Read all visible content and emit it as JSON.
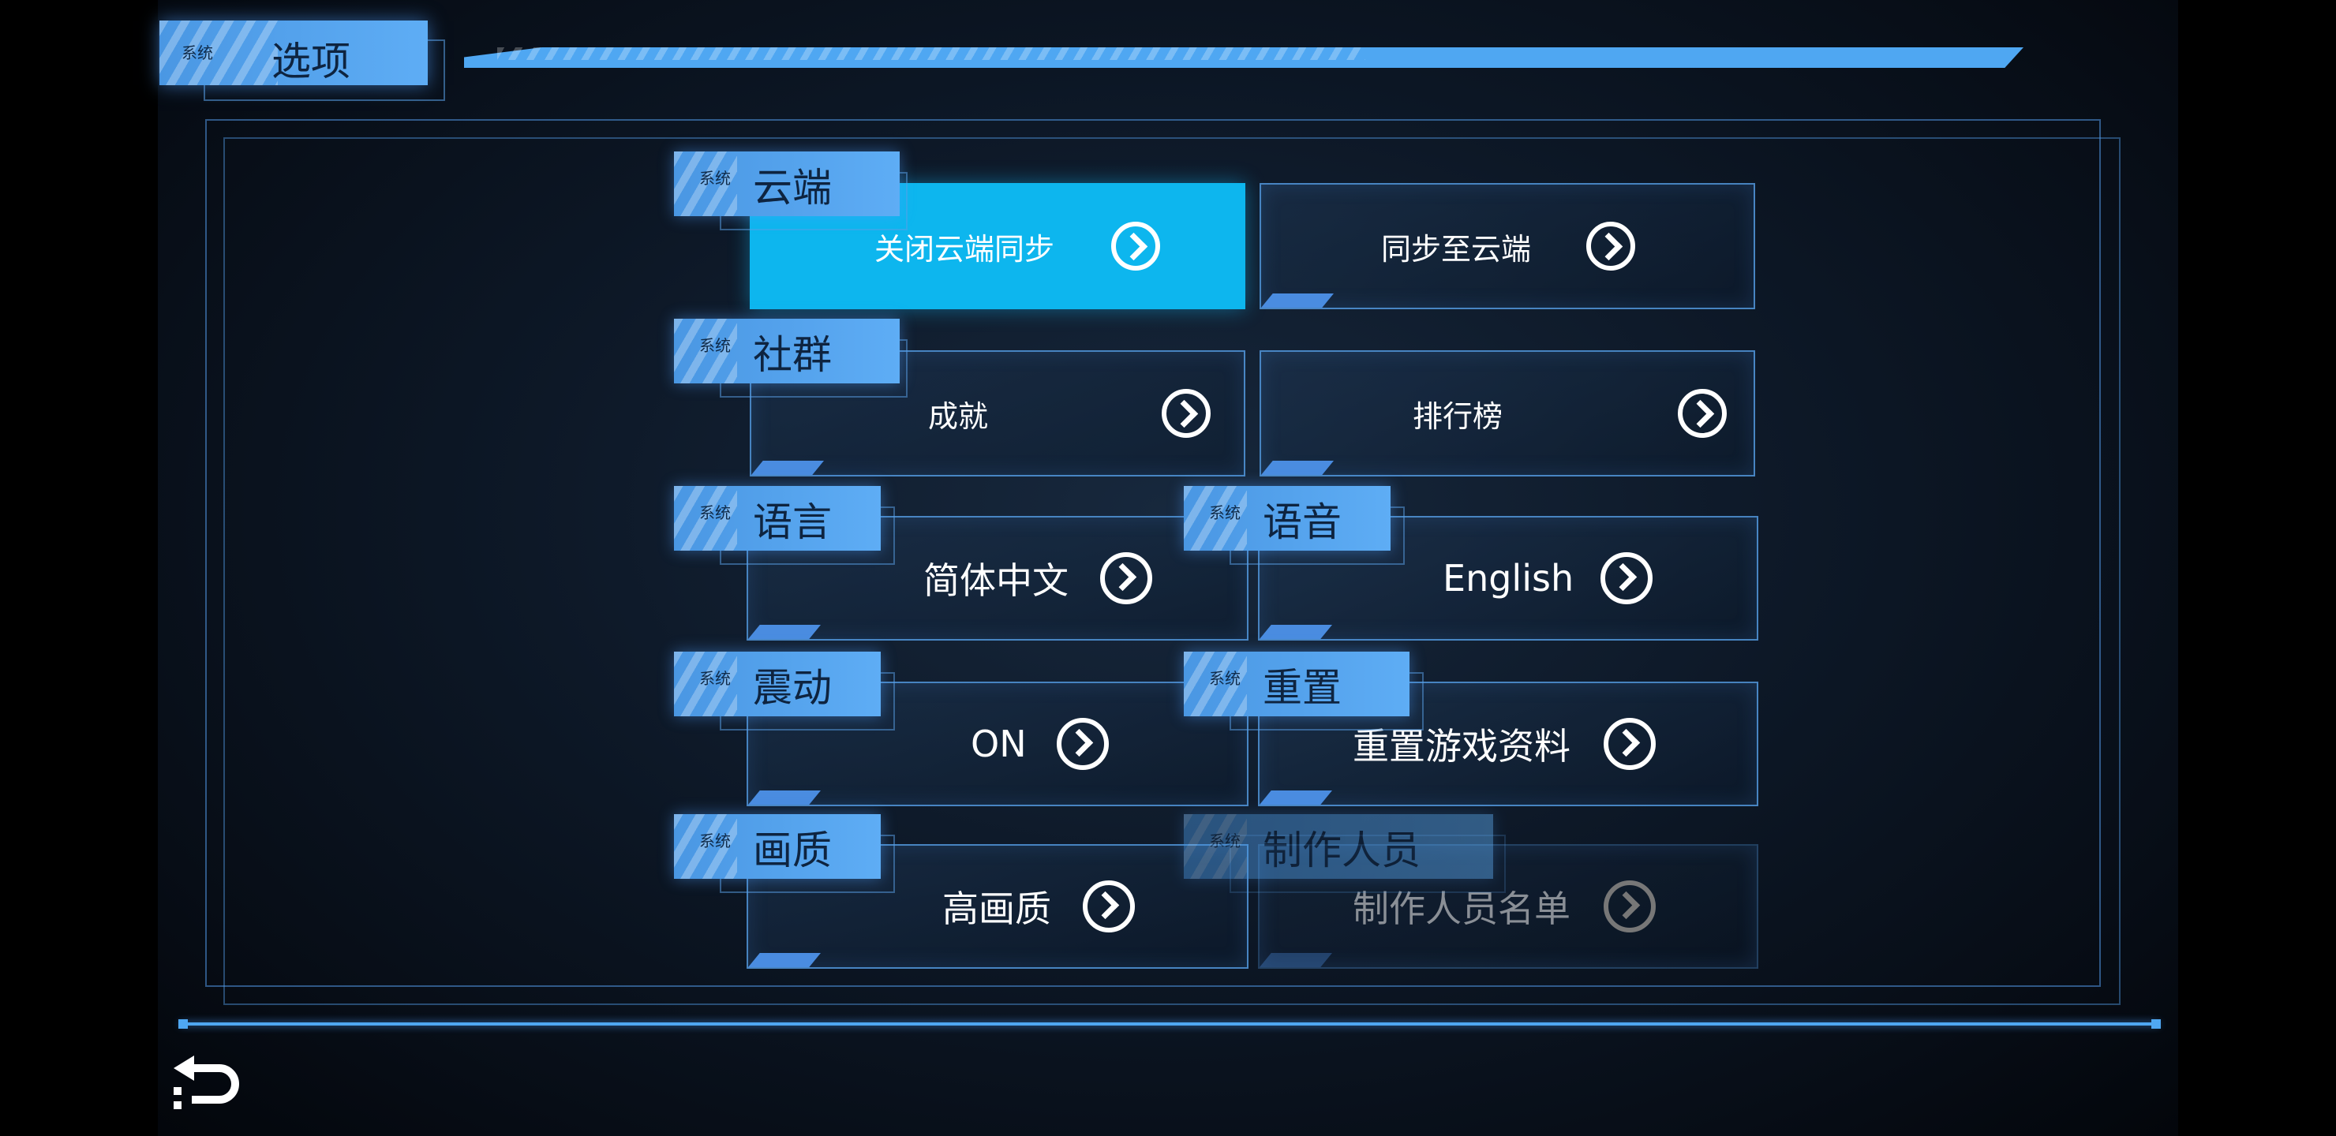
{
  "title": {
    "small": "系统",
    "label": "选项"
  },
  "sections": {
    "cloud": {
      "small": "系统",
      "label": "云端"
    },
    "community": {
      "small": "系统",
      "label": "社群"
    },
    "language": {
      "small": "系统",
      "label": "语言"
    },
    "voice": {
      "small": "系统",
      "label": "语音"
    },
    "vibration": {
      "small": "系统",
      "label": "震动"
    },
    "reset": {
      "small": "系统",
      "label": "重置"
    },
    "quality": {
      "small": "系统",
      "label": "画质"
    },
    "credits": {
      "small": "系统",
      "label": "制作人员"
    }
  },
  "buttons": {
    "close_cloud_sync": "关闭云端同步",
    "sync_to_cloud": "同步至云端",
    "achievements": "成就",
    "leaderboard": "排行榜",
    "language_value": "简体中文",
    "voice_value": "English",
    "vibration_value": "ON",
    "reset_data": "重置游戏资料",
    "quality_value": "高画质",
    "credits_list": "制作人员名单"
  },
  "icons": {
    "chevron": "chevron-right-circle-icon",
    "back": "back-arrow-icon"
  },
  "colors": {
    "accent": "#4fa7f2",
    "active": "#0db6ee",
    "background": "#0d1827"
  }
}
